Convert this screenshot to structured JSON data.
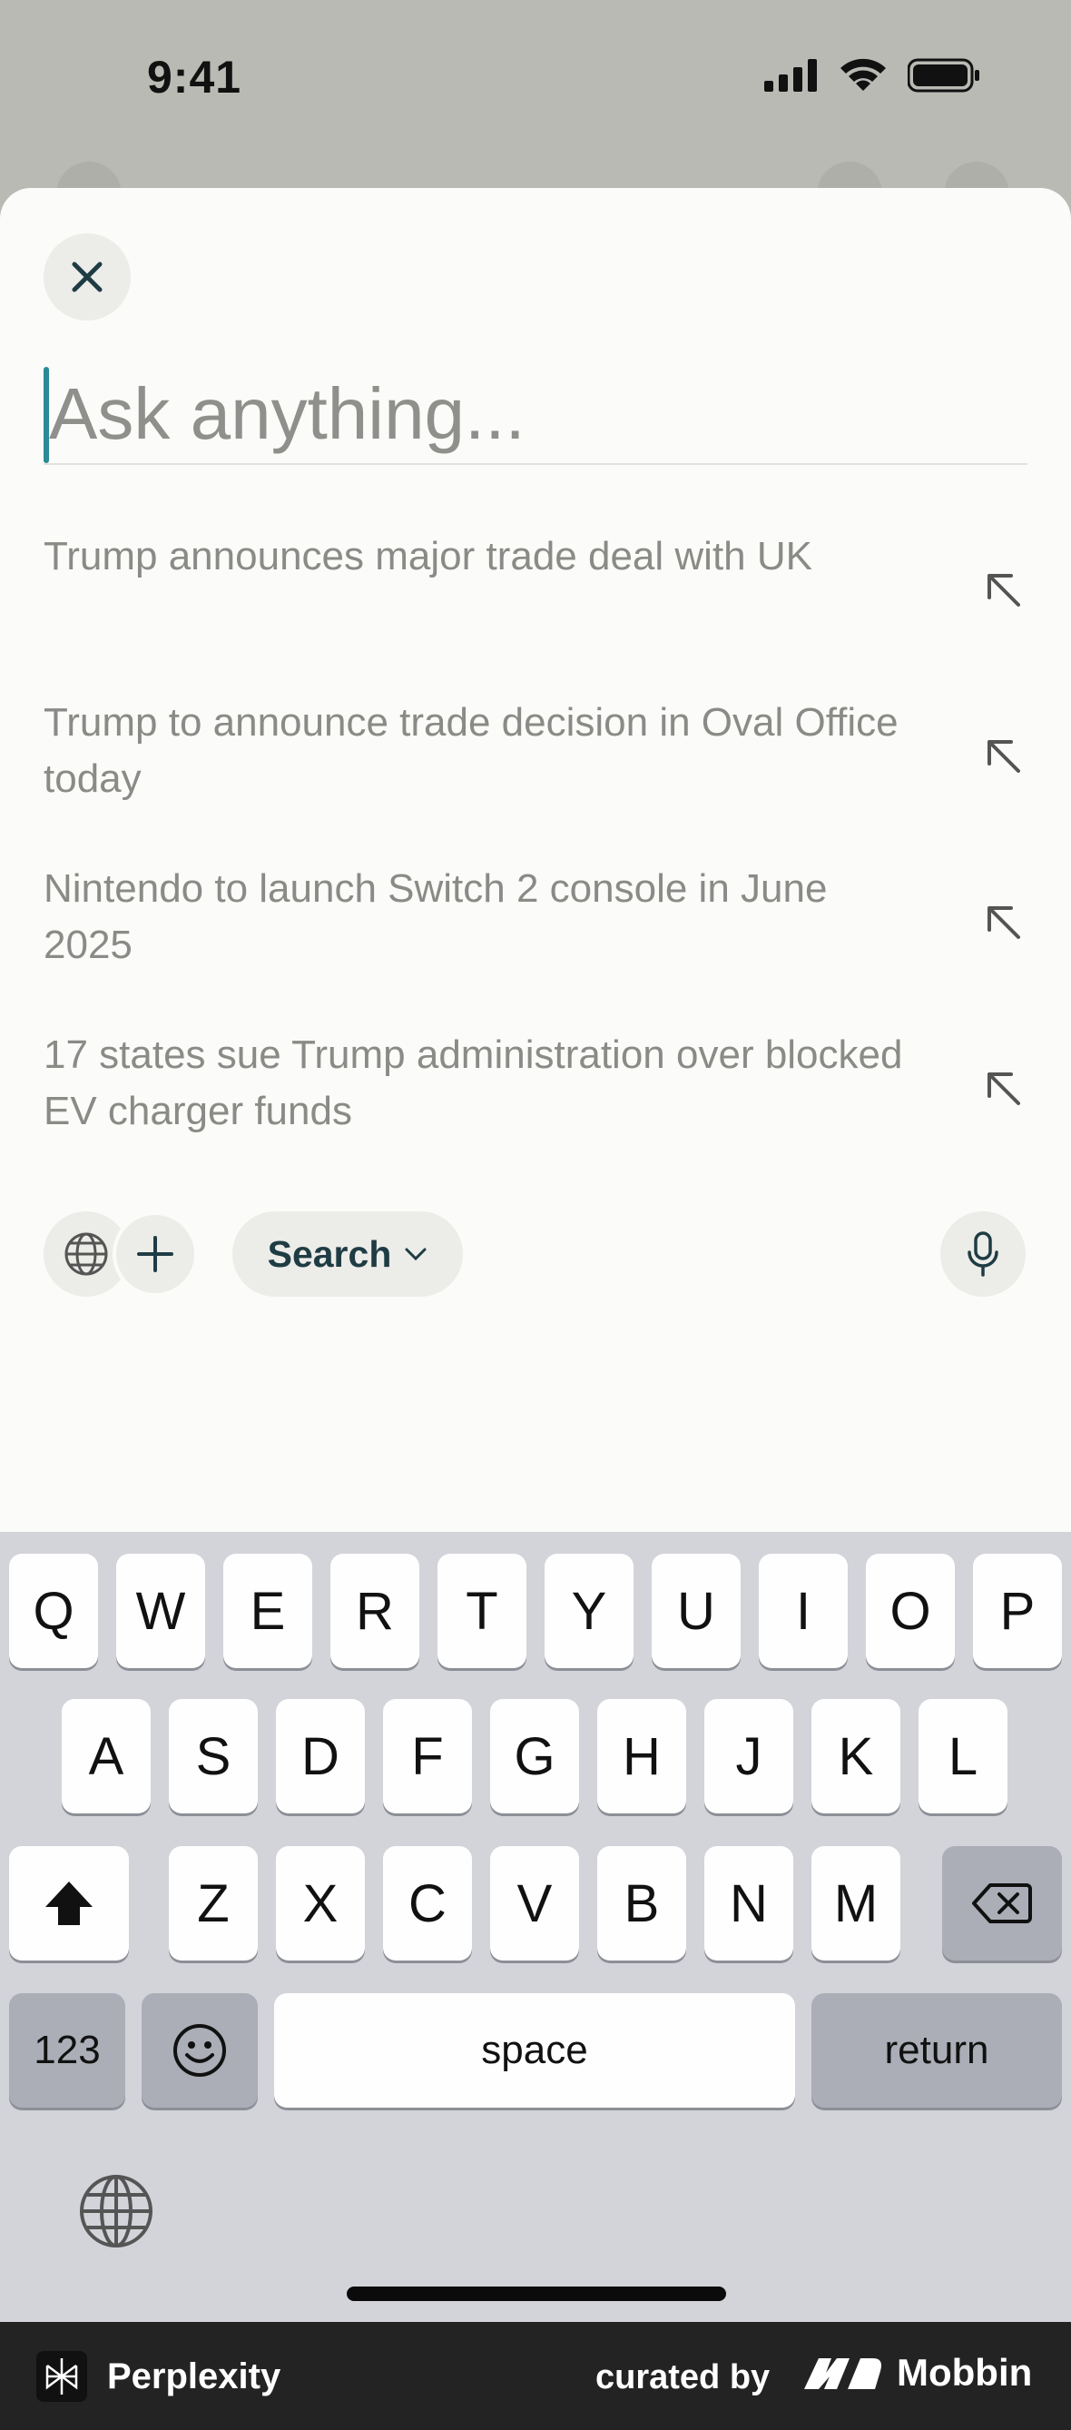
{
  "status_bar": {
    "time": "9:41"
  },
  "search": {
    "placeholder": "Ask anything..."
  },
  "suggestions": [
    {
      "text": "Trump announces major trade deal with UK"
    },
    {
      "text": "Trump to announce trade decision in Oval Office today"
    },
    {
      "text": "Nintendo to launch Switch 2 console in June 2025"
    },
    {
      "text": "17 states sue Trump administration over blocked EV charger funds"
    }
  ],
  "toolbar": {
    "mode_label": "Search"
  },
  "keyboard": {
    "row1": [
      "Q",
      "W",
      "E",
      "R",
      "T",
      "Y",
      "U",
      "I",
      "O",
      "P"
    ],
    "row2": [
      "A",
      "S",
      "D",
      "F",
      "G",
      "H",
      "J",
      "K",
      "L"
    ],
    "row3": [
      "Z",
      "X",
      "C",
      "V",
      "B",
      "N",
      "M"
    ],
    "numbers_label": "123",
    "space_label": "space",
    "return_label": "return"
  },
  "footer": {
    "app_name": "Perplexity",
    "curated_by": "curated by",
    "brand": "Mobbin"
  },
  "colors": {
    "accent": "#2b8a96",
    "sheet": "#fbfbf9",
    "keyboard": "#d3d4da"
  }
}
